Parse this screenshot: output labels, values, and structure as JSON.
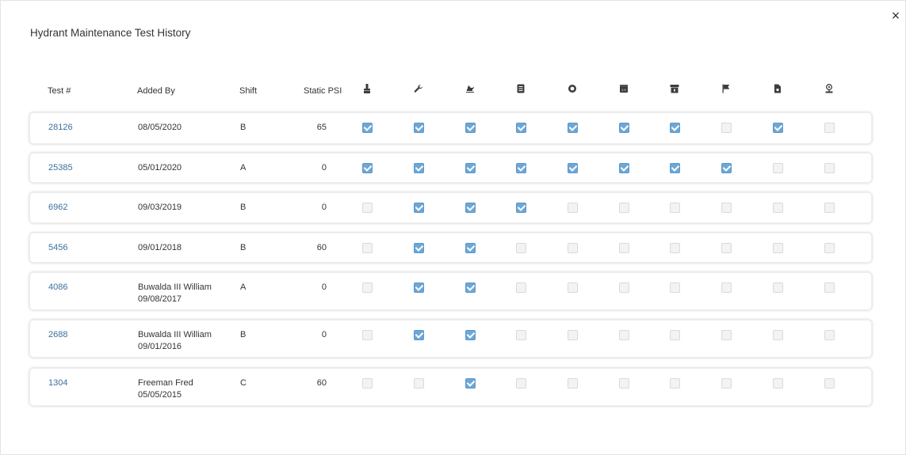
{
  "modal": {
    "title": "Hydrant Maintenance Test History",
    "close_label": "×"
  },
  "table": {
    "headers": {
      "test_no": "Test #",
      "added_by": "Added By",
      "shift": "Shift",
      "static_psi": "Static PSI"
    },
    "icon_columns": [
      "paintbrush-icon",
      "wrench-icon",
      "oil-can-icon",
      "clipboard-icon",
      "valve-cap-icon",
      "pressure-gauge-icon",
      "archive-box-icon",
      "flag-icon",
      "file-icon",
      "hydrant-marker-icon"
    ],
    "rows": [
      {
        "test_no": "28126",
        "added_by": "",
        "date": "08/05/2020",
        "shift": "B",
        "psi": "65",
        "checks": [
          true,
          true,
          true,
          true,
          true,
          true,
          true,
          false,
          true,
          false
        ]
      },
      {
        "test_no": "25385",
        "added_by": "",
        "date": "05/01/2020",
        "shift": "A",
        "psi": "0",
        "checks": [
          true,
          true,
          true,
          true,
          true,
          true,
          true,
          true,
          false,
          false
        ]
      },
      {
        "test_no": "6962",
        "added_by": "",
        "date": "09/03/2019",
        "shift": "B",
        "psi": "0",
        "checks": [
          false,
          true,
          true,
          true,
          false,
          false,
          false,
          false,
          false,
          false
        ]
      },
      {
        "test_no": "5456",
        "added_by": "",
        "date": "09/01/2018",
        "shift": "B",
        "psi": "60",
        "checks": [
          false,
          true,
          true,
          false,
          false,
          false,
          false,
          false,
          false,
          false
        ]
      },
      {
        "test_no": "4086",
        "added_by": "Buwalda III William",
        "date": "09/08/2017",
        "shift": "A",
        "psi": "0",
        "checks": [
          false,
          true,
          true,
          false,
          false,
          false,
          false,
          false,
          false,
          false
        ]
      },
      {
        "test_no": "2688",
        "added_by": "Buwalda III William",
        "date": "09/01/2016",
        "shift": "B",
        "psi": "0",
        "checks": [
          false,
          true,
          true,
          false,
          false,
          false,
          false,
          false,
          false,
          false
        ]
      },
      {
        "test_no": "1304",
        "added_by": "Freeman Fred",
        "date": "05/05/2015",
        "shift": "C",
        "psi": "60",
        "checks": [
          false,
          false,
          true,
          false,
          false,
          false,
          false,
          false,
          false,
          false
        ]
      }
    ]
  }
}
